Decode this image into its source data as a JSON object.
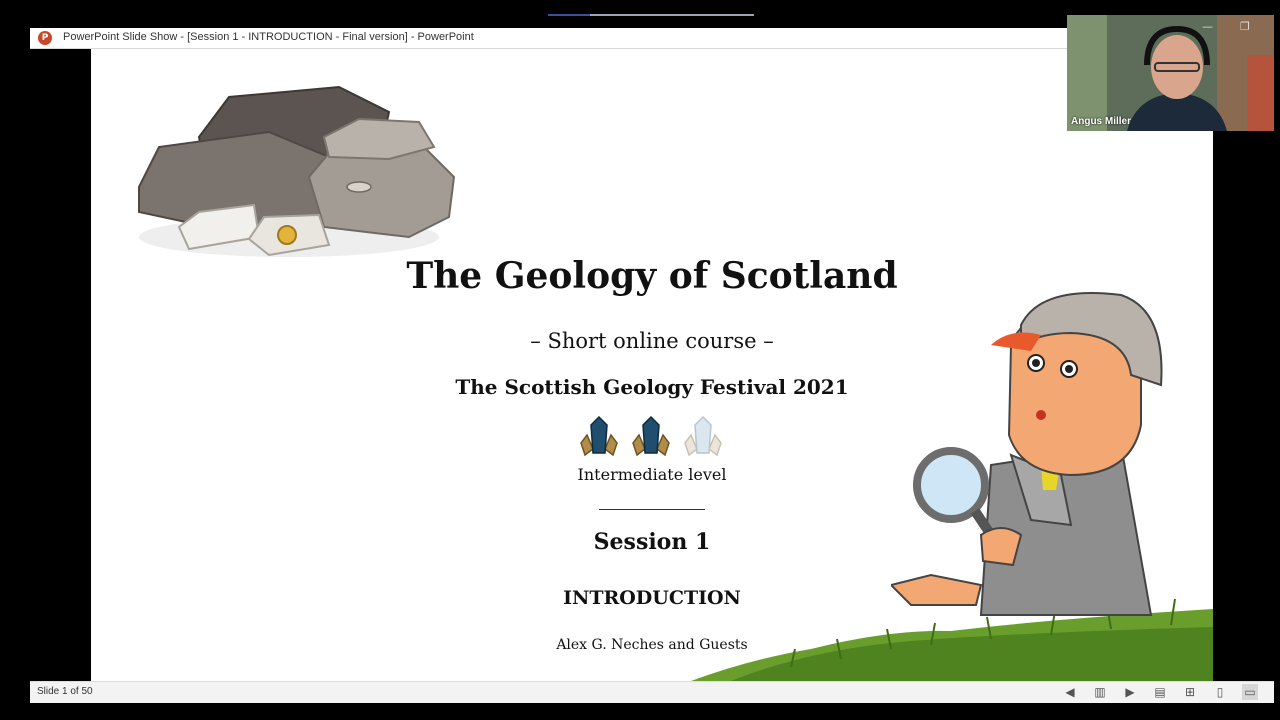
{
  "window": {
    "title": "PowerPoint Slide Show - [Session 1 - INTRODUCTION - Final version] - PowerPoint",
    "app_icon_letter": "P",
    "minimize": "—",
    "restore": "❐"
  },
  "slide": {
    "title": "The Geology of Scotland",
    "subtitle": "– Short online course –",
    "festival": "The Scottish Geology Festival 2021",
    "level": "Intermediate level",
    "session": "Session 1",
    "section": "INTRODUCTION",
    "authors": "Alex G. Neches and Guests",
    "level_rating": {
      "filled": 2,
      "total": 3
    }
  },
  "status_bar": {
    "slide_counter": "Slide 1 of 50",
    "icons": [
      "previous-icon",
      "slide-menu-icon",
      "next-icon",
      "normal-view-icon",
      "slide-sorter-icon",
      "reading-view-icon",
      "slideshow-icon"
    ]
  },
  "video": {
    "participant_name": "Angus Miller"
  },
  "colors": {
    "crystal_filled": "#1f4e6e",
    "crystal_empty": "#dbe6ee",
    "powerpoint_orange": "#c8472b"
  }
}
